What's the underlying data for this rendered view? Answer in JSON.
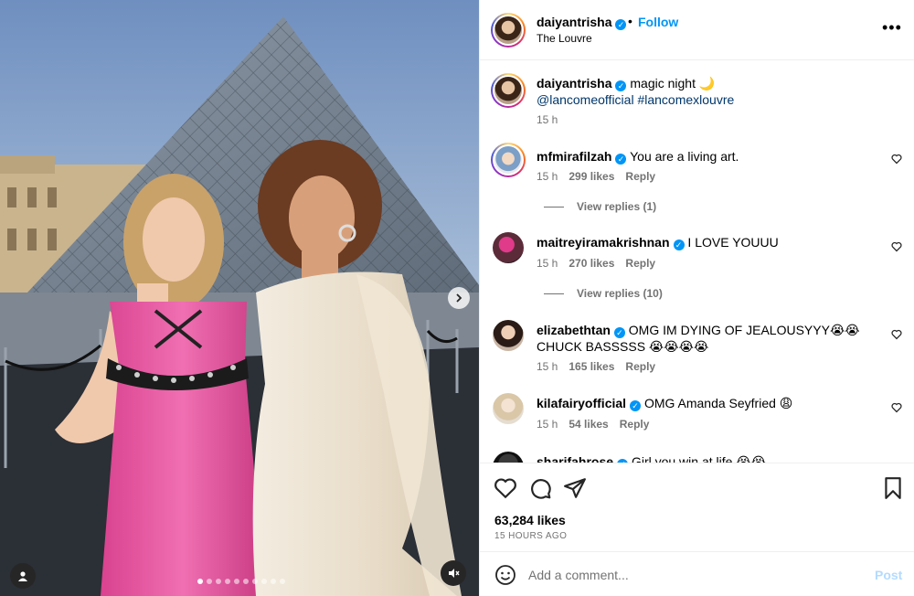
{
  "header": {
    "username": "daiyantrisha",
    "separator": "•",
    "follow_label": "Follow",
    "location": "The Louvre",
    "more_icon": "more-horizontal-icon"
  },
  "caption": {
    "username": "daiyantrisha",
    "text": "magic night 🌙",
    "mentions": "@lancomeofficial #lancomexlouvre",
    "time": "15 h"
  },
  "comments": [
    {
      "username": "mfmirafilzah",
      "verified": true,
      "text": "You are a living art.",
      "time": "15 h",
      "likes": "299 likes",
      "reply_label": "Reply",
      "view_replies": "View replies (1)"
    },
    {
      "username": "maitreyiramakrishnan",
      "verified": true,
      "text": "I LOVE YOUUU",
      "time": "15 h",
      "likes": "270 likes",
      "reply_label": "Reply",
      "view_replies": "View replies (10)"
    },
    {
      "username": "elizabethtan",
      "verified": true,
      "text": "OMG IM DYING OF JEALOUSYYY😭😭",
      "text2": "CHUCK BASSSSS 😭😭😭😭",
      "time": "15 h",
      "likes": "165 likes",
      "reply_label": "Reply"
    },
    {
      "username": "kilafairyofficial",
      "verified": true,
      "text": "OMG Amanda Seyfried 😩",
      "time": "15 h",
      "likes": "54 likes",
      "reply_label": "Reply"
    },
    {
      "username": "sharifahrose",
      "verified": true,
      "text": "Girl you win at life 😭😭"
    }
  ],
  "actions": {
    "like_icon": "heart-icon",
    "comment_icon": "comment-icon",
    "share_icon": "share-icon",
    "save_icon": "bookmark-icon",
    "likes": "63,284 likes",
    "time_ago": "15 HOURS AGO"
  },
  "add_comment": {
    "emoji_icon": "emoji-icon",
    "placeholder": "Add a comment...",
    "post_label": "Post"
  },
  "media": {
    "carousel_count": 10,
    "active_index": 0,
    "next_icon": "chevron-right-icon",
    "user_tag_icon": "user-tag-icon",
    "mute_icon": "audio-muted-icon"
  },
  "colors": {
    "accent": "#0095f6",
    "post_disabled": "#b3dbff",
    "secondary_text": "#737373",
    "mention": "#00376b"
  }
}
